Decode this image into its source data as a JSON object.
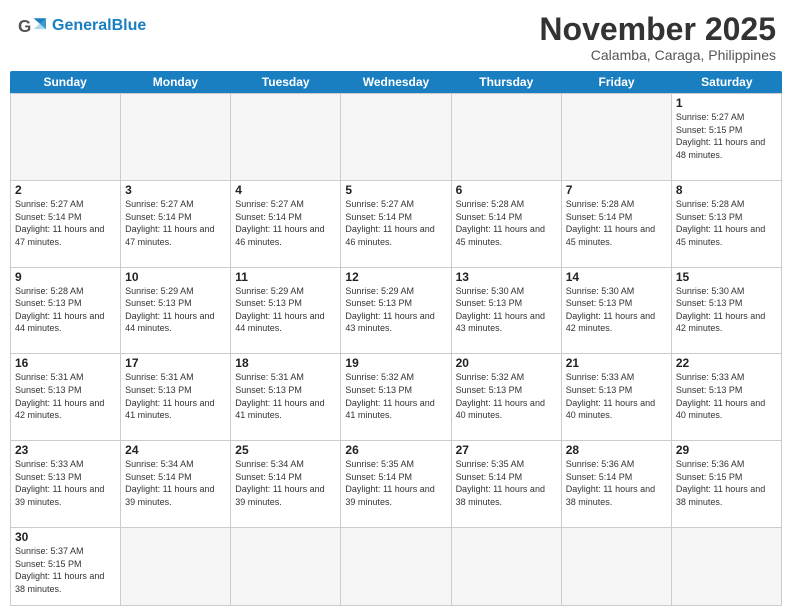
{
  "header": {
    "logo_general": "General",
    "logo_blue": "Blue",
    "month_title": "November 2025",
    "location": "Calamba, Caraga, Philippines"
  },
  "calendar": {
    "days": [
      "Sunday",
      "Monday",
      "Tuesday",
      "Wednesday",
      "Thursday",
      "Friday",
      "Saturday"
    ],
    "cells": [
      {
        "day": "",
        "empty": true
      },
      {
        "day": "",
        "empty": true
      },
      {
        "day": "",
        "empty": true
      },
      {
        "day": "",
        "empty": true
      },
      {
        "day": "",
        "empty": true
      },
      {
        "day": "",
        "empty": true
      },
      {
        "day": "1",
        "sunrise": "Sunrise: 5:27 AM",
        "sunset": "Sunset: 5:15 PM",
        "daylight": "Daylight: 11 hours and 48 minutes."
      },
      {
        "day": "2",
        "sunrise": "Sunrise: 5:27 AM",
        "sunset": "Sunset: 5:14 PM",
        "daylight": "Daylight: 11 hours and 47 minutes."
      },
      {
        "day": "3",
        "sunrise": "Sunrise: 5:27 AM",
        "sunset": "Sunset: 5:14 PM",
        "daylight": "Daylight: 11 hours and 47 minutes."
      },
      {
        "day": "4",
        "sunrise": "Sunrise: 5:27 AM",
        "sunset": "Sunset: 5:14 PM",
        "daylight": "Daylight: 11 hours and 46 minutes."
      },
      {
        "day": "5",
        "sunrise": "Sunrise: 5:27 AM",
        "sunset": "Sunset: 5:14 PM",
        "daylight": "Daylight: 11 hours and 46 minutes."
      },
      {
        "day": "6",
        "sunrise": "Sunrise: 5:28 AM",
        "sunset": "Sunset: 5:14 PM",
        "daylight": "Daylight: 11 hours and 45 minutes."
      },
      {
        "day": "7",
        "sunrise": "Sunrise: 5:28 AM",
        "sunset": "Sunset: 5:14 PM",
        "daylight": "Daylight: 11 hours and 45 minutes."
      },
      {
        "day": "8",
        "sunrise": "Sunrise: 5:28 AM",
        "sunset": "Sunset: 5:13 PM",
        "daylight": "Daylight: 11 hours and 45 minutes."
      },
      {
        "day": "9",
        "sunrise": "Sunrise: 5:28 AM",
        "sunset": "Sunset: 5:13 PM",
        "daylight": "Daylight: 11 hours and 44 minutes."
      },
      {
        "day": "10",
        "sunrise": "Sunrise: 5:29 AM",
        "sunset": "Sunset: 5:13 PM",
        "daylight": "Daylight: 11 hours and 44 minutes."
      },
      {
        "day": "11",
        "sunrise": "Sunrise: 5:29 AM",
        "sunset": "Sunset: 5:13 PM",
        "daylight": "Daylight: 11 hours and 44 minutes."
      },
      {
        "day": "12",
        "sunrise": "Sunrise: 5:29 AM",
        "sunset": "Sunset: 5:13 PM",
        "daylight": "Daylight: 11 hours and 43 minutes."
      },
      {
        "day": "13",
        "sunrise": "Sunrise: 5:30 AM",
        "sunset": "Sunset: 5:13 PM",
        "daylight": "Daylight: 11 hours and 43 minutes."
      },
      {
        "day": "14",
        "sunrise": "Sunrise: 5:30 AM",
        "sunset": "Sunset: 5:13 PM",
        "daylight": "Daylight: 11 hours and 42 minutes."
      },
      {
        "day": "15",
        "sunrise": "Sunrise: 5:30 AM",
        "sunset": "Sunset: 5:13 PM",
        "daylight": "Daylight: 11 hours and 42 minutes."
      },
      {
        "day": "16",
        "sunrise": "Sunrise: 5:31 AM",
        "sunset": "Sunset: 5:13 PM",
        "daylight": "Daylight: 11 hours and 42 minutes."
      },
      {
        "day": "17",
        "sunrise": "Sunrise: 5:31 AM",
        "sunset": "Sunset: 5:13 PM",
        "daylight": "Daylight: 11 hours and 41 minutes."
      },
      {
        "day": "18",
        "sunrise": "Sunrise: 5:31 AM",
        "sunset": "Sunset: 5:13 PM",
        "daylight": "Daylight: 11 hours and 41 minutes."
      },
      {
        "day": "19",
        "sunrise": "Sunrise: 5:32 AM",
        "sunset": "Sunset: 5:13 PM",
        "daylight": "Daylight: 11 hours and 41 minutes."
      },
      {
        "day": "20",
        "sunrise": "Sunrise: 5:32 AM",
        "sunset": "Sunset: 5:13 PM",
        "daylight": "Daylight: 11 hours and 40 minutes."
      },
      {
        "day": "21",
        "sunrise": "Sunrise: 5:33 AM",
        "sunset": "Sunset: 5:13 PM",
        "daylight": "Daylight: 11 hours and 40 minutes."
      },
      {
        "day": "22",
        "sunrise": "Sunrise: 5:33 AM",
        "sunset": "Sunset: 5:13 PM",
        "daylight": "Daylight: 11 hours and 40 minutes."
      },
      {
        "day": "23",
        "sunrise": "Sunrise: 5:33 AM",
        "sunset": "Sunset: 5:13 PM",
        "daylight": "Daylight: 11 hours and 39 minutes."
      },
      {
        "day": "24",
        "sunrise": "Sunrise: 5:34 AM",
        "sunset": "Sunset: 5:14 PM",
        "daylight": "Daylight: 11 hours and 39 minutes."
      },
      {
        "day": "25",
        "sunrise": "Sunrise: 5:34 AM",
        "sunset": "Sunset: 5:14 PM",
        "daylight": "Daylight: 11 hours and 39 minutes."
      },
      {
        "day": "26",
        "sunrise": "Sunrise: 5:35 AM",
        "sunset": "Sunset: 5:14 PM",
        "daylight": "Daylight: 11 hours and 39 minutes."
      },
      {
        "day": "27",
        "sunrise": "Sunrise: 5:35 AM",
        "sunset": "Sunset: 5:14 PM",
        "daylight": "Daylight: 11 hours and 38 minutes."
      },
      {
        "day": "28",
        "sunrise": "Sunrise: 5:36 AM",
        "sunset": "Sunset: 5:14 PM",
        "daylight": "Daylight: 11 hours and 38 minutes."
      },
      {
        "day": "29",
        "sunrise": "Sunrise: 5:36 AM",
        "sunset": "Sunset: 5:15 PM",
        "daylight": "Daylight: 11 hours and 38 minutes."
      },
      {
        "day": "30",
        "sunrise": "Sunrise: 5:37 AM",
        "sunset": "Sunset: 5:15 PM",
        "daylight": "Daylight: 11 hours and 38 minutes."
      },
      {
        "day": "",
        "empty": true
      },
      {
        "day": "",
        "empty": true
      },
      {
        "day": "",
        "empty": true
      },
      {
        "day": "",
        "empty": true
      },
      {
        "day": "",
        "empty": true
      },
      {
        "day": "",
        "empty": true
      }
    ]
  }
}
